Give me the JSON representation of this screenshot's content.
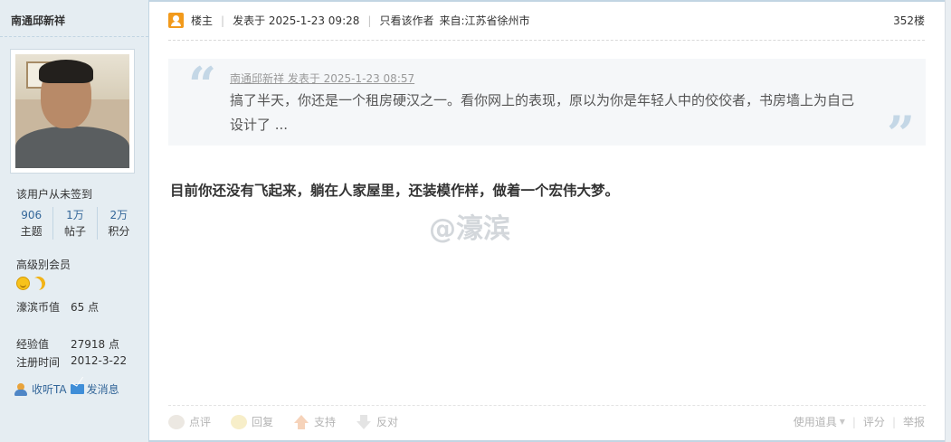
{
  "user": {
    "name": "南通邱新祥",
    "signin": "该用户从未签到",
    "stats": [
      {
        "value": "906",
        "label": "主题"
      },
      {
        "value": "1万",
        "label": "帖子"
      },
      {
        "value": "2万",
        "label": "积分"
      }
    ],
    "rank": "高级别会员",
    "coins_label": "濠滨币值",
    "coins_value": "65 点",
    "exp_label": "经验值",
    "exp_value": "27918 点",
    "reg_label": "注册时间",
    "reg_value": "2012-3-22",
    "follow_label": "收听TA",
    "message_label": "发消息"
  },
  "post": {
    "op_label": "楼主",
    "posted": "发表于 2025-1-23 09:28",
    "only_author": "只看该作者",
    "location": "来自:江苏省徐州市",
    "floor": "352楼",
    "quote_meta": "南通邱新祥 发表于 2025-1-23 08:57",
    "quote_text": "搞了半天，你还是一个租房硬汉之一。看你网上的表现，原以为你是年轻人中的佼佼者，书房墙上为自己设计了 ...",
    "message": "目前你还没有飞起来，躺在人家屋里，还装模作样，做着一个宏伟大梦。",
    "watermark": "@濠滨"
  },
  "actions": {
    "comment": "点评",
    "reply": "回复",
    "support": "支持",
    "oppose": "反对",
    "tools": "使用道具",
    "rate": "评分",
    "report": "举报"
  }
}
